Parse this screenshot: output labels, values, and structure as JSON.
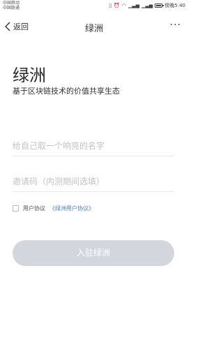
{
  "status_bar": {
    "carrier_1": "中国移动",
    "carrier_2": "中国联通",
    "time_label": "傍晚5:40",
    "icons": [
      "vibrate-icon",
      "alarm-icon",
      "wifi-icon",
      "signal-icon",
      "signal-icon",
      "battery-icon"
    ]
  },
  "nav": {
    "back_label": "返回",
    "title": "绿洲",
    "more_label": "···"
  },
  "main": {
    "title": "绿洲",
    "subtitle": "基于区块链技术的价值共享生态",
    "name_placeholder": "给自己取一个响亮的名字",
    "invite_placeholder": "邀请码（内测期间选填）",
    "agreement_prefix": "用户协议",
    "agreement_link": "《绿洲用户协议》",
    "submit_label": "入驻绿洲"
  },
  "colors": {
    "link": "#4a7fc4",
    "button_disabled": "#d3d6dd"
  }
}
